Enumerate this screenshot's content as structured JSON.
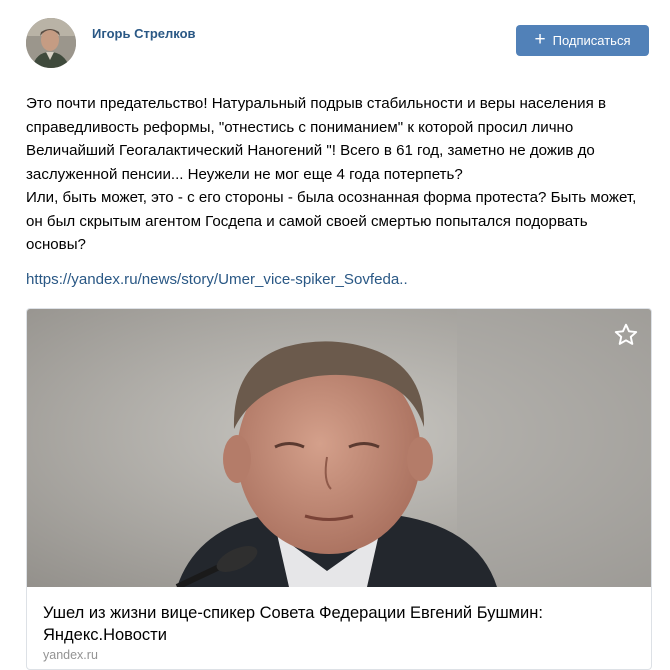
{
  "post": {
    "author": {
      "name": "Игорь Стрелков",
      "avatar_icon": "author-avatar"
    },
    "subscribe_button": {
      "icon": "plus-icon",
      "label": "Подписаться",
      "color": "#5181b8"
    },
    "text_lines": [
      "Это почти предательство! Натуральный подрыв стабильности и веры населения в справедливость реформы, \"отнестись с пониманием\" к которой просил лично Величайший Геогалактический Наногений \"! Всего в 61 год, заметно не дожив до заслуженной пенсии... Неужели не мог еще 4 года потерпеть?",
      "Или, быть может, это - с его стороны - была осознанная форма протеста? Быть может, он был скрытым агентом Госдепа и самой своей смертью попытался подорвать основы?"
    ],
    "link": "https://yandex.ru/news/story/Umer_vice-spiker_Sovfeda..",
    "link_color": "#2a5885",
    "attachment": {
      "photo": "news-photo-man-at-microphone",
      "bookmark_icon": "star-icon",
      "title": "Ушел из жизни вице-спикер Совета Федерации Евгений Бушмин: Яндекс.Новости",
      "domain": "yandex.ru"
    }
  }
}
